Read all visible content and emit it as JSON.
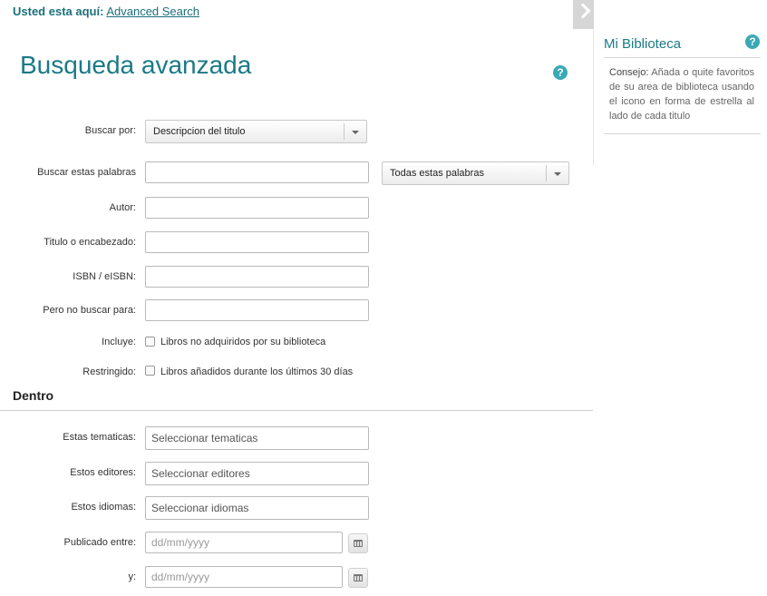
{
  "breadcrumb": {
    "label": "Usted esta aquí:",
    "link": "Advanced Search"
  },
  "page_title": "Busqueda avanzada",
  "help_glyph": "?",
  "form": {
    "buscar_por": {
      "label": "Buscar por:",
      "value": "Descripcion del titulo"
    },
    "palabras": {
      "label": "Buscar estas palabras",
      "value": "",
      "mode": "Todas estas palabras"
    },
    "autor": {
      "label": "Autor:",
      "value": ""
    },
    "titulo": {
      "label": "Titulo o encabezado:",
      "value": ""
    },
    "isbn": {
      "label": "ISBN / eISBN:",
      "value": ""
    },
    "excluir": {
      "label": "Pero no buscar para:",
      "value": ""
    },
    "incluye": {
      "label": "Incluye:",
      "option": "Libros no adquiridos por su biblioteca",
      "checked": false
    },
    "restringido": {
      "label": "Restringido:",
      "option": "Libros añadidos durante los últimos 30 días",
      "checked": false
    }
  },
  "dentro": {
    "title": "Dentro",
    "tematicas": {
      "label": "Estas tematicas:",
      "placeholder": "Seleccionar tematicas"
    },
    "editores": {
      "label": "Estos editores:",
      "placeholder": "Seleccionar editores"
    },
    "idiomas": {
      "label": "Estos idiomas:",
      "placeholder": "Seleccionar idiomas"
    },
    "publicado": {
      "label": "Publicado entre:",
      "placeholder": "dd/mm/yyyy"
    },
    "hasta": {
      "label": "y:",
      "placeholder": "dd/mm/yyyy"
    }
  },
  "sidebar": {
    "title": "Mi Biblioteca",
    "tip_label": "Consejo:",
    "tip_text": "Añada o quite favoritos de su area de biblioteca usando el icono en forma de estrella al lado de cada titulo"
  },
  "icons": {
    "help": "help-circle-icon",
    "calendar": "calendar-icon",
    "collapse": "chevron-right-icon"
  },
  "colors": {
    "accent": "#1b7a86",
    "help": "#3aa9b6"
  }
}
